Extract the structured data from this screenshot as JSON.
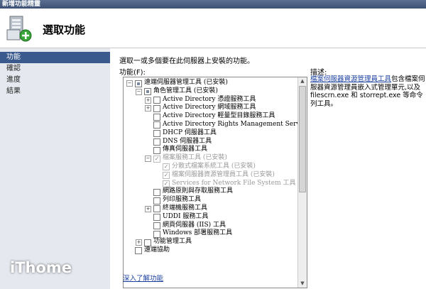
{
  "window": {
    "title": "新增功能精靈"
  },
  "header": {
    "title": "選取功能"
  },
  "nav": {
    "items": [
      {
        "label": "功能",
        "active": true
      },
      {
        "label": "確認",
        "active": false
      },
      {
        "label": "進度",
        "active": false
      },
      {
        "label": "結果",
        "active": false
      }
    ]
  },
  "main": {
    "intro": "選取一或多個要在此伺服器上安裝的功能。",
    "features_label": "功能(F):",
    "tree": [
      {
        "label": "遠端伺服器管理工具 (已安裝)",
        "level": 0,
        "expander": "minus",
        "check": "partial",
        "disabled": false
      },
      {
        "label": "角色管理工具 (已安裝)",
        "level": 1,
        "expander": "minus",
        "check": "partial",
        "disabled": false
      },
      {
        "label": "Active Directory 憑證服務工具",
        "level": 2,
        "expander": "plus",
        "check": "none",
        "disabled": false
      },
      {
        "label": "Active Directory 網域服務工具",
        "level": 2,
        "expander": "plus",
        "check": "none",
        "disabled": false
      },
      {
        "label": "Active Directory 輕量型目錄服務工具",
        "level": 2,
        "expander": "",
        "check": "none",
        "disabled": false
      },
      {
        "label": "Active Directory Rights Management Services 工具",
        "level": 2,
        "expander": "",
        "check": "none",
        "disabled": false
      },
      {
        "label": "DHCP 伺服器工具",
        "level": 2,
        "expander": "",
        "check": "none",
        "disabled": false
      },
      {
        "label": "DNS 伺服器工具",
        "level": 2,
        "expander": "",
        "check": "none",
        "disabled": false
      },
      {
        "label": "傳真伺服器工具",
        "level": 2,
        "expander": "",
        "check": "none",
        "disabled": false
      },
      {
        "label": "檔案服務工具 (已安裝)",
        "level": 2,
        "expander": "minus",
        "check": "checked",
        "disabled": true
      },
      {
        "label": "分散式檔案系統工具 (已安裝)",
        "level": 3,
        "expander": "",
        "check": "checked",
        "disabled": true
      },
      {
        "label": "檔案伺服器資源管理員工具 (已安裝)",
        "level": 3,
        "expander": "",
        "check": "checked",
        "disabled": true
      },
      {
        "label": "Services for Network File System 工具 (已安裝)",
        "level": 3,
        "expander": "",
        "check": "checked",
        "disabled": true
      },
      {
        "label": "網路原則與存取服務工具",
        "level": 2,
        "expander": "",
        "check": "none",
        "disabled": false
      },
      {
        "label": "列印服務工具",
        "level": 2,
        "expander": "",
        "check": "none",
        "disabled": false
      },
      {
        "label": "終端機服務工具",
        "level": 2,
        "expander": "plus",
        "check": "none",
        "disabled": false
      },
      {
        "label": "UDDI 服務工具",
        "level": 2,
        "expander": "",
        "check": "none",
        "disabled": false
      },
      {
        "label": "網頁伺服器 (IIS) 工具",
        "level": 2,
        "expander": "",
        "check": "none",
        "disabled": false
      },
      {
        "label": "Windows 部署服務工具",
        "level": 2,
        "expander": "",
        "check": "none",
        "disabled": false
      },
      {
        "label": "功能管理工具",
        "level": 1,
        "expander": "plus",
        "check": "none",
        "disabled": false
      },
      {
        "label": "遠端協助",
        "level": 0,
        "expander": "",
        "check": "none",
        "disabled": false
      }
    ],
    "more_link": "深入了解功能",
    "desc_title": "描述:",
    "desc_link": "檔案伺服器資源管理員工具",
    "desc_text": "包含檔案伺服器資源管理員嵌入式管理單元,以及 filescrn.exe 和 storrept.exe 等命令列工具。"
  },
  "watermark": "iThome"
}
